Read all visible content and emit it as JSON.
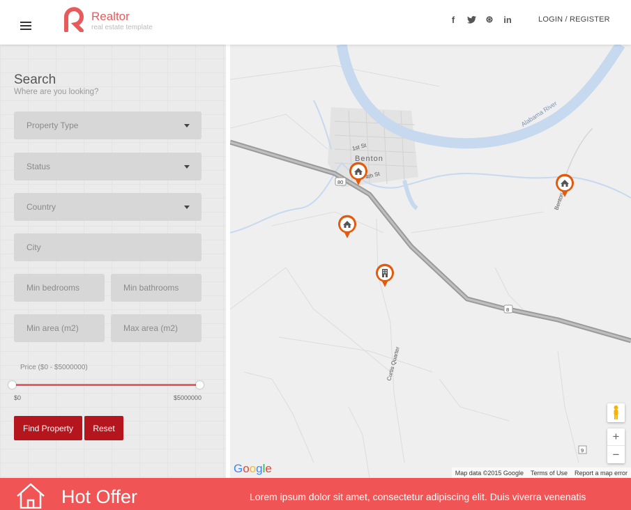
{
  "header": {
    "brand_name": "Realtor",
    "brand_tagline": "real estate template",
    "social": [
      {
        "icon": "facebook-icon",
        "glyph": "f"
      },
      {
        "icon": "twitter-icon",
        "glyph": "t"
      },
      {
        "icon": "dribbble-icon",
        "glyph": "⊛"
      },
      {
        "icon": "linkedin-icon",
        "glyph": "in"
      }
    ],
    "login_label": "LOGIN / REGISTER"
  },
  "search": {
    "title": "Search",
    "subtitle": "Where are you looking?",
    "property_type": "Property Type",
    "status": "Status",
    "country": "Country",
    "city_placeholder": "City",
    "min_bedrooms_placeholder": "Min bedrooms",
    "min_bathrooms_placeholder": "Min bathrooms",
    "min_area_placeholder": "Min area (m2)",
    "max_area_placeholder": "Max area (m2)",
    "price_label": "Price ($0 - $5000000)",
    "price_min": "$0",
    "price_max": "$5000000",
    "find_button": "Find Property",
    "reset_button": "Reset"
  },
  "map": {
    "town_label": "Benton",
    "street_1": "1st St",
    "street_2": "4th St",
    "river_label": "Alabama River",
    "road_label": "Benton",
    "curtis_label": "Curtis Quarter",
    "shield_80": "80",
    "shield_8": "8",
    "shield_9": "9",
    "google_letters": [
      "G",
      "o",
      "o",
      "g",
      "l",
      "e"
    ],
    "zoom_in": "+",
    "zoom_out": "−",
    "attribution": "Map data ©2015 Google",
    "terms": "Terms of Use",
    "report": "Report a map error",
    "colors": {
      "pin": "#e25a0c",
      "water": "#c6d9ef",
      "road": "#999999"
    }
  },
  "footer": {
    "title": "Hot Offer",
    "text": "Lorem ipsum dolor sit amet, consectetur adipiscing elit. Duis viverra venenatis"
  },
  "colors": {
    "accent": "#f05454",
    "button": "#b5161e"
  }
}
